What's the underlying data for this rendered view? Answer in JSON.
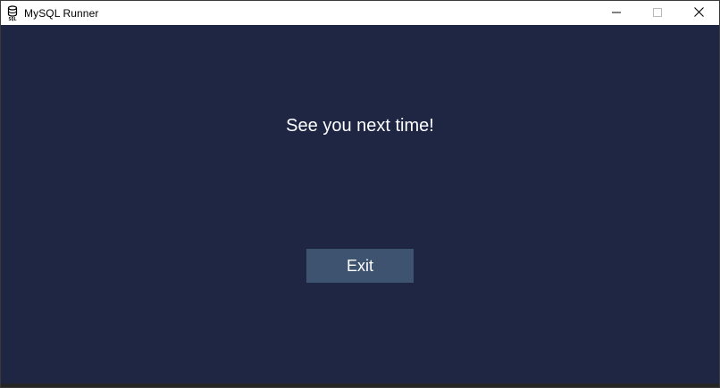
{
  "window": {
    "title": "MySQL Runner",
    "app_icon": "sql-database-icon",
    "controls": {
      "minimize_icon": "minimize-icon",
      "maximize_icon": "maximize-icon",
      "close_icon": "close-icon"
    }
  },
  "main": {
    "message": "See you next time!",
    "exit_label": "Exit"
  },
  "colors": {
    "background": "#1e2644",
    "button": "#3d5370",
    "text": "#ffffff"
  }
}
